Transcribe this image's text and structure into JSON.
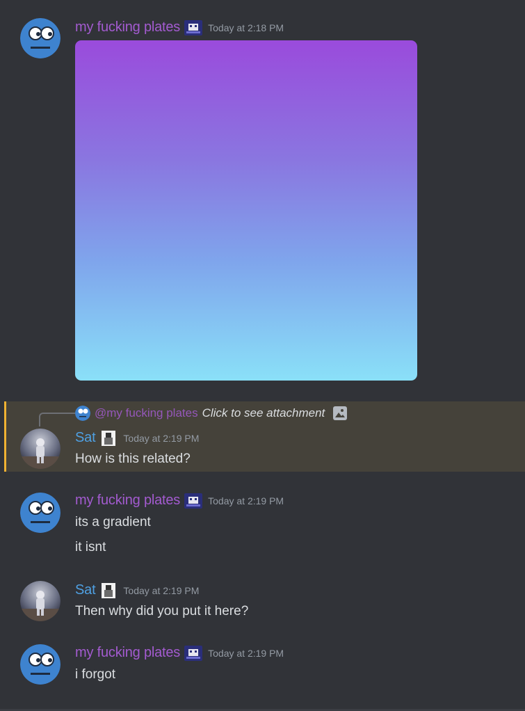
{
  "messages": [
    {
      "author": "my fucking plates",
      "timestamp": "Today at 2:18 PM",
      "attachment": "image-gradient"
    },
    {
      "author": "Sat",
      "timestamp": "Today at 2:19 PM",
      "reply": {
        "mention": "@my fucking plates",
        "text": "Click to see attachment"
      },
      "lines": [
        "How is this related?"
      ]
    },
    {
      "author": "my fucking plates",
      "timestamp": "Today at 2:19 PM",
      "lines": [
        "its a gradient",
        "it isnt"
      ]
    },
    {
      "author": "Sat",
      "timestamp": "Today at 2:19 PM",
      "lines": [
        "Then why did you put it here?"
      ]
    },
    {
      "author": "my fucking plates",
      "timestamp": "Today at 2:19 PM",
      "lines": [
        "i forgot"
      ]
    }
  ],
  "colors": {
    "background": "#313338",
    "author_plates": "#a35bd0",
    "author_sat": "#4fa0e2",
    "highlight": "#45423a",
    "highlight_bar": "#f0b232",
    "timestamp": "#949ba4"
  },
  "icons": {
    "plates_avatar": "blue-face-avatar",
    "sat_avatar": "astronaut-avatar",
    "plates_badge": "pixel-badge-icon",
    "sat_badge": "portrait-badge-icon",
    "reply_attachment": "image-icon"
  }
}
